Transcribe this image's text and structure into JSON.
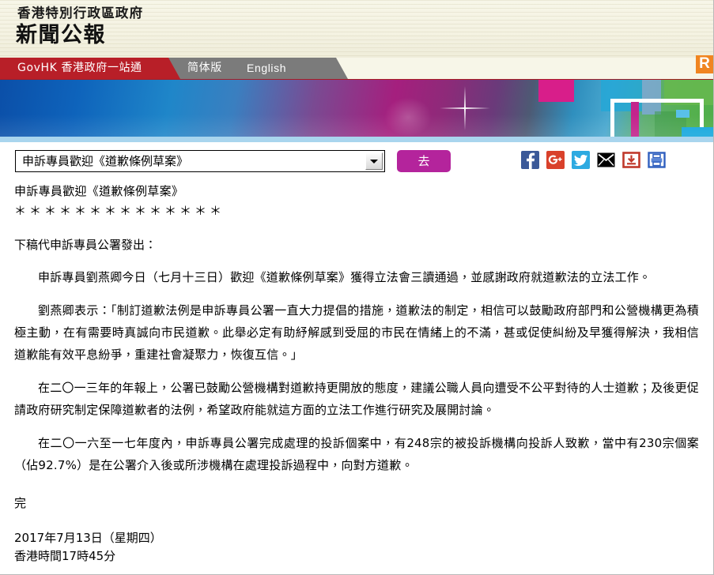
{
  "masthead": {
    "department": "香港特別行政區政府",
    "title": "新聞公報",
    "rss_badge": "R"
  },
  "nav": {
    "govhk": "GovHK 香港政府一站通",
    "simplified": "简体版",
    "english": "English"
  },
  "controls": {
    "selected_option": "申訴專員歡迎《道歉條例草案》",
    "go_label": "去",
    "social": [
      {
        "name": "facebook-icon",
        "label": "f"
      },
      {
        "name": "google-plus-icon",
        "label": "g+"
      },
      {
        "name": "twitter-icon",
        "label": "t"
      },
      {
        "name": "email-icon",
        "label": "mail"
      },
      {
        "name": "download-icon",
        "label": "download"
      },
      {
        "name": "print-icon",
        "label": "print"
      }
    ]
  },
  "article": {
    "title": "申訴專員歡迎《道歉條例草案》",
    "stars": "＊＊＊＊＊＊＊＊＊＊＊＊＊＊",
    "issued_by": "下稿代申訴專員公署發出：",
    "paragraphs": [
      "申訴專員劉燕卿今日（七月十三日）歡迎《道歉條例草案》獲得立法會三讀通過，並感謝政府就道歉法的立法工作。",
      "劉燕卿表示：「制訂道歉法例是申訴專員公署一直大力提倡的措施，道歉法的制定，相信可以鼓勵政府部門和公營機構更為積極主動，在有需要時真誠向市民道歉。此舉必定有助紓解感到受屈的市民在情緒上的不滿，甚或促使糾紛及早獲得解決，我相信道歉能有效平息紛爭，重建社會凝聚力，恢復互信。」",
      "在二〇一三年的年報上，公署已鼓勵公營機構對道歉持更開放的態度，建議公職人員向遭受不公平對待的人士道歉；及後更促請政府研究制定保障道歉者的法例，希望政府能就這方面的立法工作進行研究及展開討論。",
      "在二〇一六至一七年度內，申訴專員公署完成處理的投訴個案中，有248宗的被投訴機構向投訴人致歉，當中有230宗個案（佔92.7%）是在公署介入後或所涉機構在處理投訴過程中，向對方道歉。"
    ],
    "end_mark": "完",
    "date": "2017年7月13日（星期四）",
    "time": "香港時間17時45分"
  },
  "colors": {
    "nav_red": "#b81f28",
    "nav_gray": "#7b7b7b",
    "go_button": "#b4249c",
    "rss_orange": "#f08521",
    "banner_underline": "#a9d5ee",
    "masthead_cream": "#f7f6e8"
  }
}
